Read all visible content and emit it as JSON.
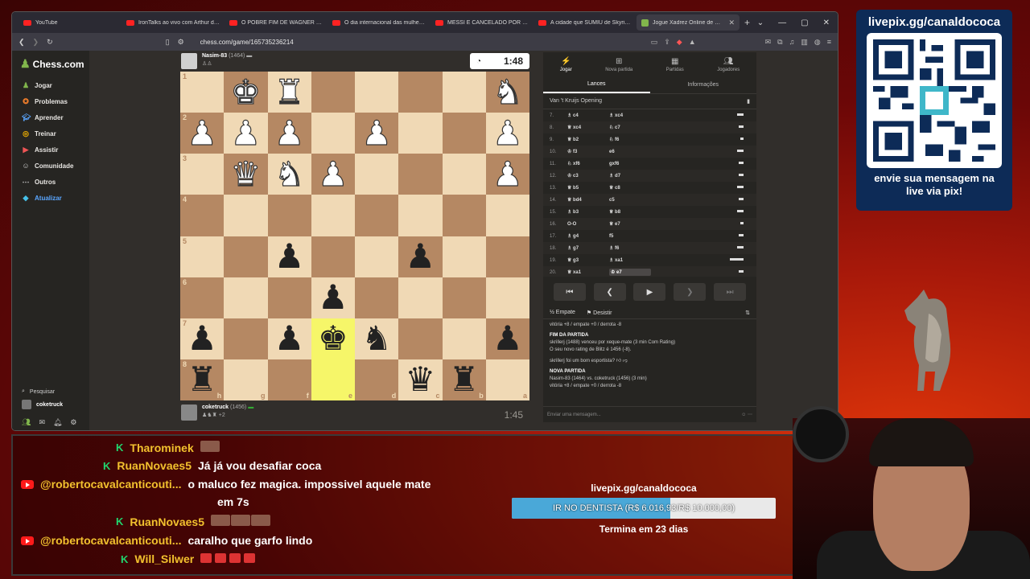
{
  "browser": {
    "tabs": [
      {
        "icon": "youtube",
        "title": "YouTube"
      },
      {
        "icon": "youtube",
        "title": "IronTalks ao vivo com Arthur do Val"
      },
      {
        "icon": "youtube",
        "title": "O POBRE FIM DE WAGNER MOURA"
      },
      {
        "icon": "youtube",
        "title": "O dia internacional das mulheres é u"
      },
      {
        "icon": "youtube",
        "title": "MESSI É CANCELADO POR ESQUER"
      },
      {
        "icon": "youtube",
        "title": "A cidade que SUMIU de Skyrim - Yo"
      },
      {
        "icon": "chess",
        "title": "Jogue Xadrez Online de GRÁ",
        "active": true
      }
    ],
    "url": "chess.com/game/165735236214"
  },
  "sidebar": {
    "brand": "Chess.com",
    "items": [
      {
        "label": "Jogar",
        "icon": "play-icon"
      },
      {
        "label": "Problemas",
        "icon": "puzzle-icon"
      },
      {
        "label": "Aprender",
        "icon": "learn-icon"
      },
      {
        "label": "Treinar",
        "icon": "train-icon"
      },
      {
        "label": "Assistir",
        "icon": "watch-icon"
      },
      {
        "label": "Comunidade",
        "icon": "community-icon"
      },
      {
        "label": "Outros",
        "icon": "more-icon"
      },
      {
        "label": "Atualizar",
        "icon": "diamond-icon"
      }
    ],
    "search": "Pesquisar",
    "user": "coketruck"
  },
  "game": {
    "top_player": {
      "name": "Nasim-83",
      "rating": "(1464)",
      "clock": "1:48"
    },
    "bottom_player": {
      "name": "coketruck",
      "rating": "(1456)",
      "clock": "1:45"
    },
    "board": {
      "ranks": [
        "1",
        "2",
        "3",
        "4",
        "5",
        "6",
        "7",
        "8"
      ],
      "files": [
        "h",
        "g",
        "f",
        "e",
        "d",
        "c",
        "b",
        "a"
      ],
      "rows": [
        [
          "",
          "wK",
          "wR",
          "",
          "",
          "",
          "",
          "wN"
        ],
        [
          "wP",
          "wP",
          "wP",
          "",
          "wP",
          "",
          "",
          "wP"
        ],
        [
          "",
          "wQ",
          "wN",
          "wP",
          "",
          "",
          "",
          "wP"
        ],
        [
          "",
          "",
          "",
          "",
          "",
          "",
          "",
          ""
        ],
        [
          "",
          "",
          "bP",
          "",
          "",
          "bP",
          "",
          ""
        ],
        [
          "",
          "",
          "",
          "bP",
          "",
          "",
          "",
          ""
        ],
        [
          "bP",
          "",
          "bP",
          "bK",
          "bN",
          "",
          "",
          "bP"
        ],
        [
          "bR",
          "",
          "",
          "",
          "",
          "bQ",
          "bR",
          ""
        ]
      ],
      "highlight": [
        [
          6,
          3
        ],
        [
          7,
          3
        ]
      ]
    }
  },
  "panel": {
    "tabs": [
      {
        "label": "Jogar",
        "icon": "bolt-icon"
      },
      {
        "label": "Nova partida",
        "icon": "plus-icon"
      },
      {
        "label": "Partidas",
        "icon": "grid-icon"
      },
      {
        "label": "Jogadores",
        "icon": "users-icon"
      }
    ],
    "subtabs": [
      "Lances",
      "Informações"
    ],
    "opening": "Van 't Kruijs Opening",
    "moves": [
      {
        "n": "7.",
        "w": "♗ c4",
        "b": "♗ xc4",
        "t": 0.3
      },
      {
        "n": "8.",
        "w": "♕ xc4",
        "b": "♘ c7",
        "t": 0.2
      },
      {
        "n": "9.",
        "w": "♕ b2",
        "b": "♘ f6",
        "t": 0.15
      },
      {
        "n": "10.",
        "w": "♔ f3",
        "b": "e6",
        "t": 0.3
      },
      {
        "n": "11.",
        "w": "♘ xf6",
        "b": "gxf6",
        "t": 0.2
      },
      {
        "n": "12.",
        "w": "♔ c3",
        "b": "♗ d7",
        "t": 0.2
      },
      {
        "n": "13.",
        "w": "♕ b5",
        "b": "♕ c8",
        "t": 0.3
      },
      {
        "n": "14.",
        "w": "♕ bd4",
        "b": "c5",
        "t": 0.2
      },
      {
        "n": "15.",
        "w": "♗ b3",
        "b": "♕ b8",
        "t": 0.3
      },
      {
        "n": "16.",
        "w": "O-O",
        "b": "♕ e7",
        "t": 0.15
      },
      {
        "n": "17.",
        "w": "♗ g4",
        "b": "f5",
        "t": 0.2
      },
      {
        "n": "18.",
        "w": "♗ g7",
        "b": "♗ f6",
        "t": 0.3
      },
      {
        "n": "19.",
        "w": "♕ g3",
        "b": "♗ xa1",
        "t": 0.6
      },
      {
        "n": "20.",
        "w": "♕ xa1",
        "b": "♔ e7",
        "t": 0.2,
        "current": true
      }
    ],
    "actions": {
      "draw": "Empate",
      "resign": "Desistir"
    },
    "log": {
      "record": "vitória +8 / empate +0 / derrota -8",
      "end_title": "FIM DA PARTIDA",
      "end_text": "skrillerj (1488) venceu por xeque-mate (3 min Com Rating)",
      "rating_text": "O seu novo rating de Blitz é 1456 (-8).",
      "sport": "skrillerj foi um bom esportista?",
      "new_title": "NOVA PARTIDA",
      "new_text": "Nasim-83 (1464) vs. coketruck (1456) (3 min)",
      "new_record": "vitória +8 / empate +0 / derrota -8"
    },
    "chat_placeholder": "Enviar uma mensagem..."
  },
  "qr": {
    "top": "livepix.gg/canaldococa",
    "bottom1": "envie sua mensagem na",
    "bottom2": "live via pix!"
  },
  "chat": [
    {
      "platform": "kick",
      "user": "Tharominek",
      "msg": ""
    },
    {
      "platform": "kick",
      "user": "RuanNovaes5",
      "msg": "Já já vou desafiar coca"
    },
    {
      "platform": "youtube",
      "user": "@robertocavalcanticouti...",
      "msg": "o maluco fez magica. impossivel aquele mate"
    },
    {
      "platform": "",
      "user": "",
      "msg": "em 7s"
    },
    {
      "platform": "kick",
      "user": "RuanNovaes5",
      "msg": ""
    },
    {
      "platform": "youtube",
      "user": "@robertocavalcanticouti...",
      "msg": "caralho que garfo lindo"
    },
    {
      "platform": "kick",
      "user": "Will_Silwer",
      "msg": ""
    }
  ],
  "donation": {
    "url": "livepix.gg/canaldococa",
    "bar_text": "IR NO DENTISTA (R$ 6.016,93/R$ 10.000,00)",
    "progress": 0.6017,
    "ends": "Termina em 23 dias"
  }
}
